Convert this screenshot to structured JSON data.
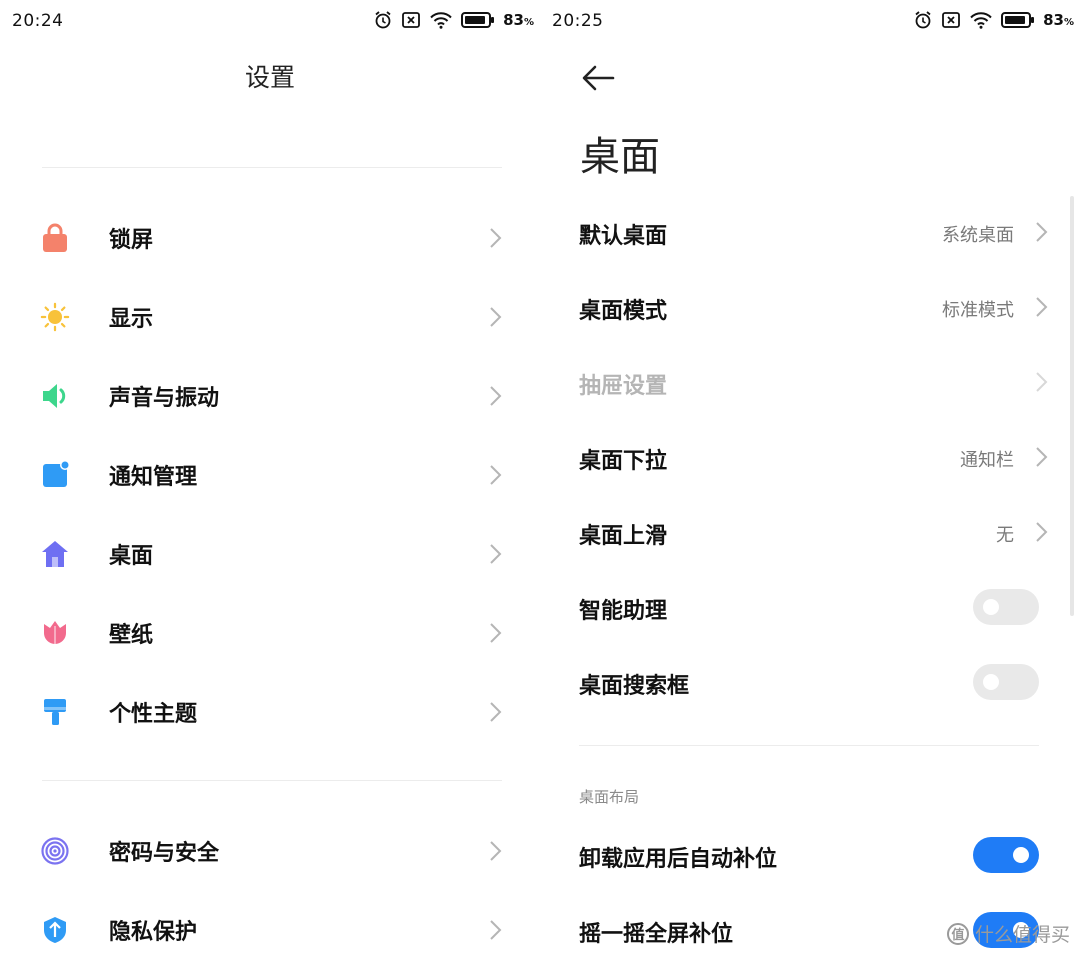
{
  "left_screen": {
    "status_bar": {
      "time": "20:24",
      "battery": "83",
      "battery_unit": "%"
    },
    "title": "设置",
    "items": [
      {
        "label": "锁屏",
        "icon": "lock-icon",
        "color": "#F4826B"
      },
      {
        "label": "显示",
        "icon": "sun-icon",
        "color": "#F8C23A"
      },
      {
        "label": "声音与振动",
        "icon": "speaker-icon",
        "color": "#3DD68C"
      },
      {
        "label": "通知管理",
        "icon": "notification-icon",
        "color": "#2F9BF5"
      },
      {
        "label": "桌面",
        "icon": "home-icon",
        "color": "#6E6FF2"
      },
      {
        "label": "壁纸",
        "icon": "tulip-icon",
        "color": "#F26A8D"
      },
      {
        "label": "个性主题",
        "icon": "paint-brush-icon",
        "color": "#2F9BF5"
      },
      {
        "label": "密码与安全",
        "icon": "fingerprint-icon",
        "color": "#7B73F0"
      },
      {
        "label": "隐私保护",
        "icon": "privacy-shield-icon",
        "color": "#2F9BF5"
      }
    ]
  },
  "right_screen": {
    "status_bar": {
      "time": "20:25",
      "battery": "83",
      "battery_unit": "%"
    },
    "title": "桌面",
    "rows": [
      {
        "label": "默认桌面",
        "value": "系统桌面",
        "type": "nav",
        "enabled": true
      },
      {
        "label": "桌面模式",
        "value": "标准模式",
        "type": "nav",
        "enabled": true
      },
      {
        "label": "抽屉设置",
        "value": "",
        "type": "nav",
        "enabled": false
      },
      {
        "label": "桌面下拉",
        "value": "通知栏",
        "type": "nav",
        "enabled": true
      },
      {
        "label": "桌面上滑",
        "value": "无",
        "type": "nav",
        "enabled": true
      },
      {
        "label": "智能助理",
        "type": "toggle",
        "on": false
      },
      {
        "label": "桌面搜索框",
        "type": "toggle",
        "on": false
      }
    ],
    "section_header": "桌面布局",
    "section_rows": [
      {
        "label": "卸载应用后自动补位",
        "type": "toggle",
        "on": true
      },
      {
        "label": "摇一摇全屏补位",
        "type": "toggle",
        "on": true
      }
    ],
    "accent_color": "#1F7CF6"
  },
  "watermark": {
    "badge": "值",
    "text": "什么值得买"
  }
}
